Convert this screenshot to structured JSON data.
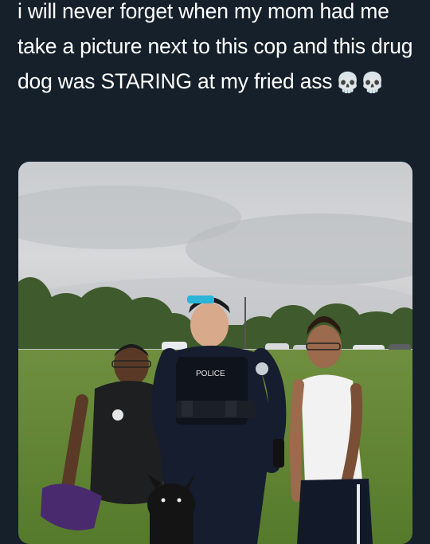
{
  "tweet": {
    "text": "i will never forget when my mom had me take a picture next to this cop and this drug dog was STARING at my fried ass",
    "emojis": "💀💀"
  },
  "photo": {
    "badges": {
      "police_vest": "POLICE"
    }
  }
}
